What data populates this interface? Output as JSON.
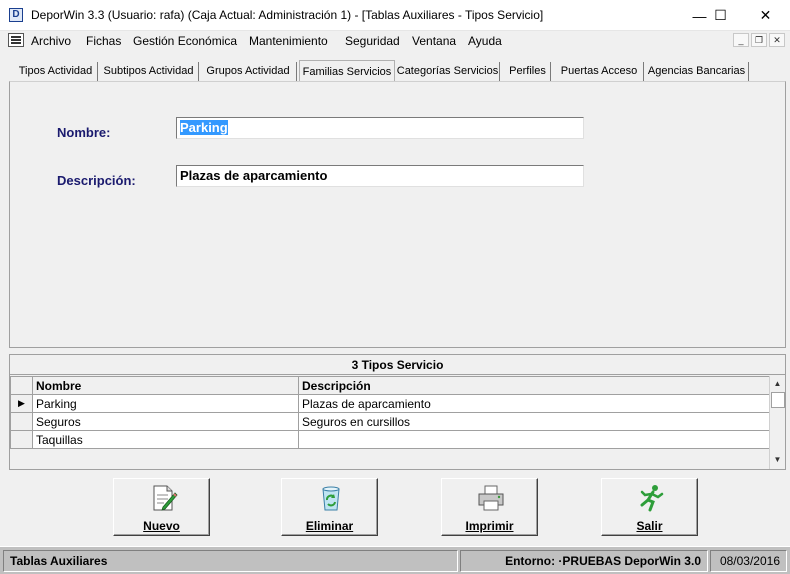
{
  "window": {
    "app_icon_letter": "D",
    "title": "DeporWin 3.3  (Usuario: rafa)  (Caja Actual: Administración 1) - [Tablas Auxiliares - Tipos Servicio]",
    "minimize_glyph": "—",
    "maximize_glyph": "☐",
    "close_glyph": "✕"
  },
  "menu": {
    "items": [
      "Archivo",
      "Fichas",
      "Gestión Económica",
      "Mantenimiento",
      "Seguridad",
      "Ventana",
      "Ayuda"
    ],
    "mdi_minimize": "_",
    "mdi_restore": "❐",
    "mdi_close": "✕"
  },
  "tabs": [
    "Tipos Actividad",
    "Subtipos Actividad",
    "Grupos Actividad",
    "Familias Servicios",
    "Categorías Servicios",
    "Perfiles",
    "Puertas Acceso",
    "Agencias Bancarias"
  ],
  "active_tab": "Familias Servicios",
  "form": {
    "nombre_label": "Nombre:",
    "nombre_value": "Parking",
    "descripcion_label": "Descripción:",
    "descripcion_value": "Plazas de aparcamiento"
  },
  "grid": {
    "caption": "3 Tipos Servicio",
    "columns": [
      "Nombre",
      "Descripción"
    ],
    "rows": [
      {
        "nombre": "Parking",
        "descripcion": "Plazas de aparcamiento"
      },
      {
        "nombre": "Seguros",
        "descripcion": "Seguros en cursillos"
      },
      {
        "nombre": "Taquillas",
        "descripcion": ""
      }
    ],
    "current_row_marker": "▶",
    "scroll_up": "▲",
    "scroll_down": "▼"
  },
  "buttons": {
    "nuevo": "Nuevo",
    "eliminar": "Eliminar",
    "imprimir": "Imprimir",
    "salir": "Salir"
  },
  "status": {
    "left": "Tablas Auxiliares",
    "entorno": "Entorno: ·PRUEBAS DeporWin 3.0",
    "date": "08/03/2016"
  },
  "icons": {
    "app": "deporwin-app-icon",
    "nuevo": "new-document-pencil-icon",
    "eliminar": "recycle-bin-icon",
    "imprimir": "printer-icon",
    "salir": "running-man-exit-icon"
  }
}
